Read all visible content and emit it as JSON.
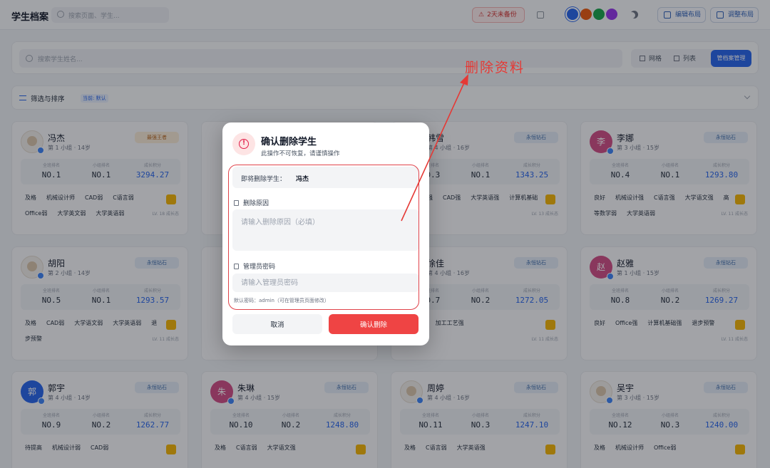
{
  "header": {
    "title": "学生档案",
    "search_placeholder": "搜索页面、学生...",
    "backup_status": "2天未备份",
    "edit_layout": "编辑布局",
    "adjust_layout": "调整布局",
    "theme_colors": [
      "#2563eb",
      "#ea580c",
      "#16a34a",
      "#9333ea"
    ]
  },
  "toolbar": {
    "search_placeholder": "搜索学生姓名...",
    "grid_label": "网格",
    "list_label": "列表",
    "archive_button": "管档案管理",
    "filter_label": "筛选与排序",
    "filter_tag": "当前: 默认"
  },
  "labels": {
    "total_rank": "全班排名",
    "group_rank": "小组排名",
    "growth_score": "成长积分"
  },
  "students": [
    {
      "name": "冯杰",
      "info": "第 1 小组 · 14岁",
      "badge": "最强王者",
      "badge_style": "gold",
      "avatar": "",
      "avatar_color": "photo",
      "total": "NO.1",
      "group": "NO.1",
      "score": "3294.27",
      "tags": [
        "及格",
        "机械设计师",
        "CAD弱",
        "C语言弱",
        "Office弱",
        "大学英文弱",
        "大学英语弱"
      ],
      "lv": "LV. 18 成长态"
    },
    {
      "name": "",
      "info": "",
      "badge": "",
      "badge_style": "",
      "avatar": "",
      "avatar_color": "photo",
      "total": "",
      "group": "",
      "score": "",
      "tags": [],
      "lv": ""
    },
    {
      "name": "韩雪",
      "info": "第 4 小组 · 16岁",
      "badge": "永恒钻石",
      "badge_style": "blue",
      "avatar": "",
      "avatar_color": "photo",
      "total": "NO.3",
      "group": "NO.1",
      "score": "1343.25",
      "tags": [
        "机械设计强",
        "CAD强",
        "大学英语强",
        "计算机基础强"
      ],
      "lv": "LV. 13 成长态"
    },
    {
      "name": "李娜",
      "info": "第 3 小组 · 15岁",
      "badge": "永恒钻石",
      "badge_style": "blue",
      "avatar": "李",
      "avatar_color": "#d14b83",
      "total": "NO.4",
      "group": "NO.1",
      "score": "1293.80",
      "tags": [
        "良好",
        "机械设计强",
        "C语言强",
        "大学语文强",
        "高等数学弱",
        "大学英语弱"
      ],
      "lv": "LV. 11 成长态"
    },
    {
      "name": "胡阳",
      "info": "第 2 小组 · 14岁",
      "badge": "永恒钻石",
      "badge_style": "blue",
      "avatar": "",
      "avatar_color": "photo",
      "total": "NO.5",
      "group": "NO.1",
      "score": "1293.57",
      "tags": [
        "及格",
        "CAD弱",
        "大学语文弱",
        "大学英语弱",
        "退步预警"
      ],
      "lv": "LV. 11 成长态"
    },
    {
      "name": "",
      "info": "",
      "badge": "",
      "badge_style": "",
      "avatar": "",
      "avatar_color": "photo",
      "total": "",
      "group": "",
      "score": "",
      "tags": [],
      "lv": ""
    },
    {
      "name": "徐佳",
      "info": "第 4 小组 · 16岁",
      "badge": "永恒钻石",
      "badge_style": "blue",
      "avatar": "",
      "avatar_color": "photo",
      "total": "NO.7",
      "group": "NO.2",
      "score": "1272.05",
      "tags": [
        "C语言弱",
        "加工工艺强"
      ],
      "lv": "LV. 11 成长态"
    },
    {
      "name": "赵雅",
      "info": "第 1 小组 · 15岁",
      "badge": "永恒钻石",
      "badge_style": "blue",
      "avatar": "赵",
      "avatar_color": "#d14b83",
      "total": "NO.8",
      "group": "NO.2",
      "score": "1269.27",
      "tags": [
        "良好",
        "Office强",
        "计算机基础强",
        "退步预警"
      ],
      "lv": "LV. 11 成长态"
    },
    {
      "name": "郭宇",
      "info": "第 4 小组 · 14岁",
      "badge": "永恒钻石",
      "badge_style": "blue",
      "avatar": "郭",
      "avatar_color": "#2563eb",
      "total": "NO.9",
      "group": "NO.2",
      "score": "1262.77",
      "tags": [
        "待提高",
        "机械设计弱",
        "CAD弱"
      ],
      "lv": ""
    },
    {
      "name": "朱琳",
      "info": "第 4 小组 · 15岁",
      "badge": "永恒钻石",
      "badge_style": "blue",
      "avatar": "朱",
      "avatar_color": "#d14b83",
      "total": "NO.10",
      "group": "NO.2",
      "score": "1248.80",
      "tags": [
        "及格",
        "C语言弱",
        "大学语文强"
      ],
      "lv": ""
    },
    {
      "name": "周婷",
      "info": "第 4 小组 · 16岁",
      "badge": "永恒钻石",
      "badge_style": "blue",
      "avatar": "",
      "avatar_color": "photo",
      "total": "NO.11",
      "group": "NO.3",
      "score": "1247.10",
      "tags": [
        "及格",
        "C语言弱",
        "大学英语强"
      ],
      "lv": ""
    },
    {
      "name": "吴宇",
      "info": "第 3 小组 · 15岁",
      "badge": "永恒钻石",
      "badge_style": "blue",
      "avatar": "",
      "avatar_color": "photo",
      "total": "NO.12",
      "group": "NO.3",
      "score": "1240.00",
      "tags": [
        "及格",
        "机械设计师",
        "Office弱"
      ],
      "lv": ""
    }
  ],
  "modal": {
    "title": "确认删除学生",
    "subtitle": "此操作不可恢复，请谨慎操作",
    "target_label": "即将删除学生：",
    "target_name": "冯杰",
    "reason_label": "删除原因",
    "reason_placeholder": "请输入删除原因（必填）",
    "password_label": "管理员密码",
    "password_placeholder": "请输入管理员密码",
    "password_hint": "默认密码：admin（可在管理员页面修改）",
    "cancel_label": "取消",
    "confirm_label": "确认删除"
  },
  "annotation": {
    "text": "删除资料",
    "color": "#e53935"
  }
}
